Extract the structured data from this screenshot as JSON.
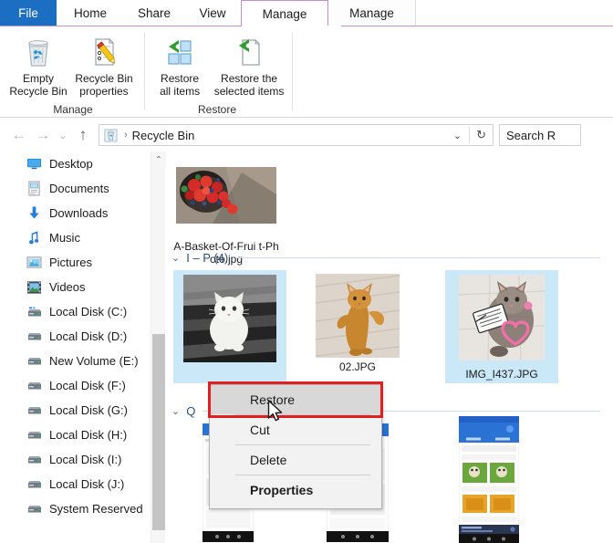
{
  "window": {
    "title": "Recycle Bin"
  },
  "ribbon": {
    "tabs": [
      {
        "label": "File",
        "name": "tab-file",
        "kind": "file"
      },
      {
        "label": "Home",
        "name": "tab-home",
        "kind": "plain"
      },
      {
        "label": "Share",
        "name": "tab-share",
        "kind": "plain"
      },
      {
        "label": "View",
        "name": "tab-view",
        "kind": "plain"
      },
      {
        "label": "Manage",
        "name": "tab-manage-active",
        "kind": "ctx-active"
      },
      {
        "label": "Manage",
        "name": "tab-manage-second",
        "kind": "ctx-inactive"
      }
    ],
    "groups": [
      {
        "label": "Manage",
        "buttons": [
          {
            "label": "Empty\nRecycle Bin",
            "icon": "recycle-bin-icon"
          },
          {
            "label": "Recycle Bin\nproperties",
            "icon": "properties-icon"
          }
        ]
      },
      {
        "label": "Restore",
        "buttons": [
          {
            "label": "Restore\nall items",
            "icon": "restore-all-icon"
          },
          {
            "label": "Restore the\nselected items",
            "icon": "restore-selected-icon"
          }
        ]
      }
    ],
    "accent_color": "#c68bd0",
    "file_tab_color": "#1b6ec2"
  },
  "addressbar": {
    "back_glyph": "←",
    "forward_glyph": "→",
    "history_glyph": "⌄",
    "up_glyph": "↑",
    "path": "Recycle Bin",
    "separator": "›",
    "dropdown_glyph": "⌄",
    "refresh_glyph": "↻",
    "search_placeholder": "Search R"
  },
  "sidebar": {
    "items": [
      {
        "label": "Desktop",
        "icon": "desktop-icon"
      },
      {
        "label": "Documents",
        "icon": "documents-icon"
      },
      {
        "label": "Downloads",
        "icon": "downloads-icon"
      },
      {
        "label": "Music",
        "icon": "music-icon"
      },
      {
        "label": "Pictures",
        "icon": "pictures-icon"
      },
      {
        "label": "Videos",
        "icon": "videos-icon"
      },
      {
        "label": "Local Disk (C:)",
        "icon": "system-drive-icon"
      },
      {
        "label": "Local Disk (D:)",
        "icon": "drive-icon"
      },
      {
        "label": "New Volume (E:)",
        "icon": "drive-icon"
      },
      {
        "label": "Local Disk (F:)",
        "icon": "drive-icon"
      },
      {
        "label": "Local Disk (G:)",
        "icon": "drive-icon"
      },
      {
        "label": "Local Disk (H:)",
        "icon": "drive-icon"
      },
      {
        "label": "Local Disk (I:)",
        "icon": "drive-icon"
      },
      {
        "label": "Local Disk (J:)",
        "icon": "drive-icon"
      },
      {
        "label": "System Reserved",
        "icon": "drive-icon"
      }
    ],
    "scrollbar": {
      "up_glyph": "⌃"
    }
  },
  "content": {
    "first_file": {
      "label": "A-Basket-Of-Frui\nt-Photo.jpg"
    },
    "groups": [
      {
        "label": "I – P (4)",
        "chevron": "⌄"
      },
      {
        "label": "Q",
        "chevron": "⌄"
      }
    ],
    "files_row": [
      {
        "label": "",
        "selected": true
      },
      {
        "label": "02.JPG",
        "selected": false
      },
      {
        "label": "IMG_I437.JPG",
        "selected": true
      }
    ]
  },
  "context_menu": {
    "items": [
      {
        "label": "Restore",
        "highlight": true,
        "bold": false
      },
      {
        "label": "Cut",
        "highlight": false,
        "bold": false
      },
      {
        "label": "Delete",
        "highlight": false,
        "bold": false
      },
      {
        "label": "Properties",
        "highlight": false,
        "bold": true
      }
    ],
    "annotation_color": "#e02020"
  }
}
